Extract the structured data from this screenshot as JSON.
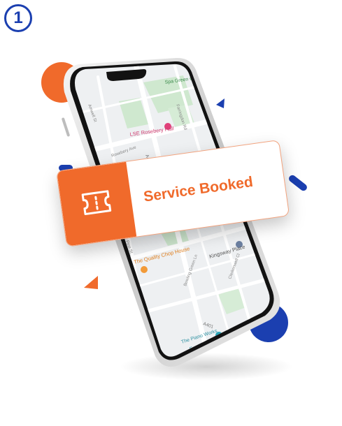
{
  "step": {
    "number": "1"
  },
  "card": {
    "title": "Service Booked",
    "icon": "ticket-icon"
  },
  "map": {
    "places": {
      "spa_green_garden": "Spa Green\nGarden",
      "lse_rosebery_hall": "LSE Rosebery Hall",
      "the_quality_chop_house": "The Quality Chop House",
      "kingsway_place": "Kingsway Place",
      "the_piano_works": "The Piano Works\nFarringdon"
    },
    "roads": {
      "a401": "A401",
      "a401_lower": "A401",
      "amwell_st": "Amwell St",
      "rosebery_ave": "Rosebery Ave",
      "pine_st": "Pine St",
      "bowling_green_ln": "Bowling Green Ln",
      "clerkenwell_cl": "Clerkenwell Cl",
      "farringdon_rd": "Farringdon Rd"
    }
  },
  "colors": {
    "brand_orange": "#f06a2b",
    "brand_blue": "#1b3fb0",
    "map_park": "#cfe8cf",
    "map_road": "#ffffff",
    "map_base": "#eef0f2"
  }
}
